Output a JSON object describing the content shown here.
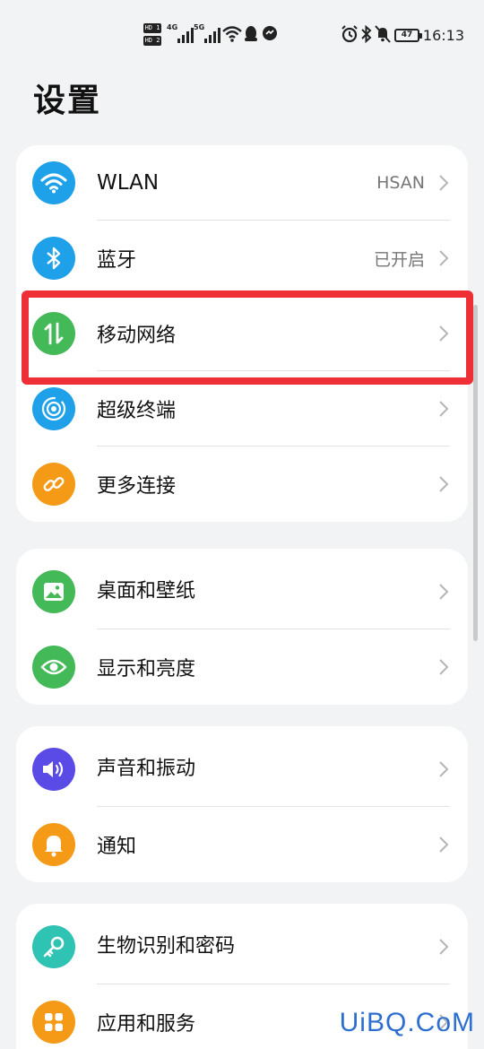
{
  "status_bar": {
    "sim1": "HD 1",
    "sim2": "HD 2",
    "net1": "4G",
    "net2": "5G",
    "battery": "47",
    "time": "16:13",
    "icons": [
      "wifi-icon",
      "qq-icon",
      "message-icon",
      "alarm-icon",
      "bluetooth-icon",
      "mute-icon"
    ]
  },
  "title": "设置",
  "groups": [
    {
      "items": [
        {
          "label": "WLAN",
          "value": "HSAN",
          "icon": "wifi-icon",
          "color": "#1ea1e8"
        },
        {
          "label": "蓝牙",
          "value": "已开启",
          "icon": "bluetooth-icon",
          "color": "#1ea1e8"
        },
        {
          "label": "移动网络",
          "value": "",
          "icon": "mobile-data-icon",
          "color": "#43b958"
        },
        {
          "label": "超级终端",
          "value": "",
          "icon": "super-device-icon",
          "color": "#1ea1e8"
        },
        {
          "label": "更多连接",
          "value": "",
          "icon": "link-icon",
          "color": "#f59a16"
        }
      ]
    },
    {
      "items": [
        {
          "label": "桌面和壁纸",
          "value": "",
          "icon": "wallpaper-icon",
          "color": "#43b958"
        },
        {
          "label": "显示和亮度",
          "value": "",
          "icon": "eye-icon",
          "color": "#43b958"
        }
      ]
    },
    {
      "items": [
        {
          "label": "声音和振动",
          "value": "",
          "icon": "sound-icon",
          "color": "#5b4be6"
        },
        {
          "label": "通知",
          "value": "",
          "icon": "bell-icon",
          "color": "#f59a16"
        }
      ]
    },
    {
      "items": [
        {
          "label": "生物识别和密码",
          "value": "",
          "icon": "key-icon",
          "color": "#2fc3b3"
        },
        {
          "label": "应用和服务",
          "value": "",
          "icon": "apps-icon",
          "color": "#f59a16"
        }
      ]
    }
  ],
  "watermark": "UiBQ.CoM"
}
